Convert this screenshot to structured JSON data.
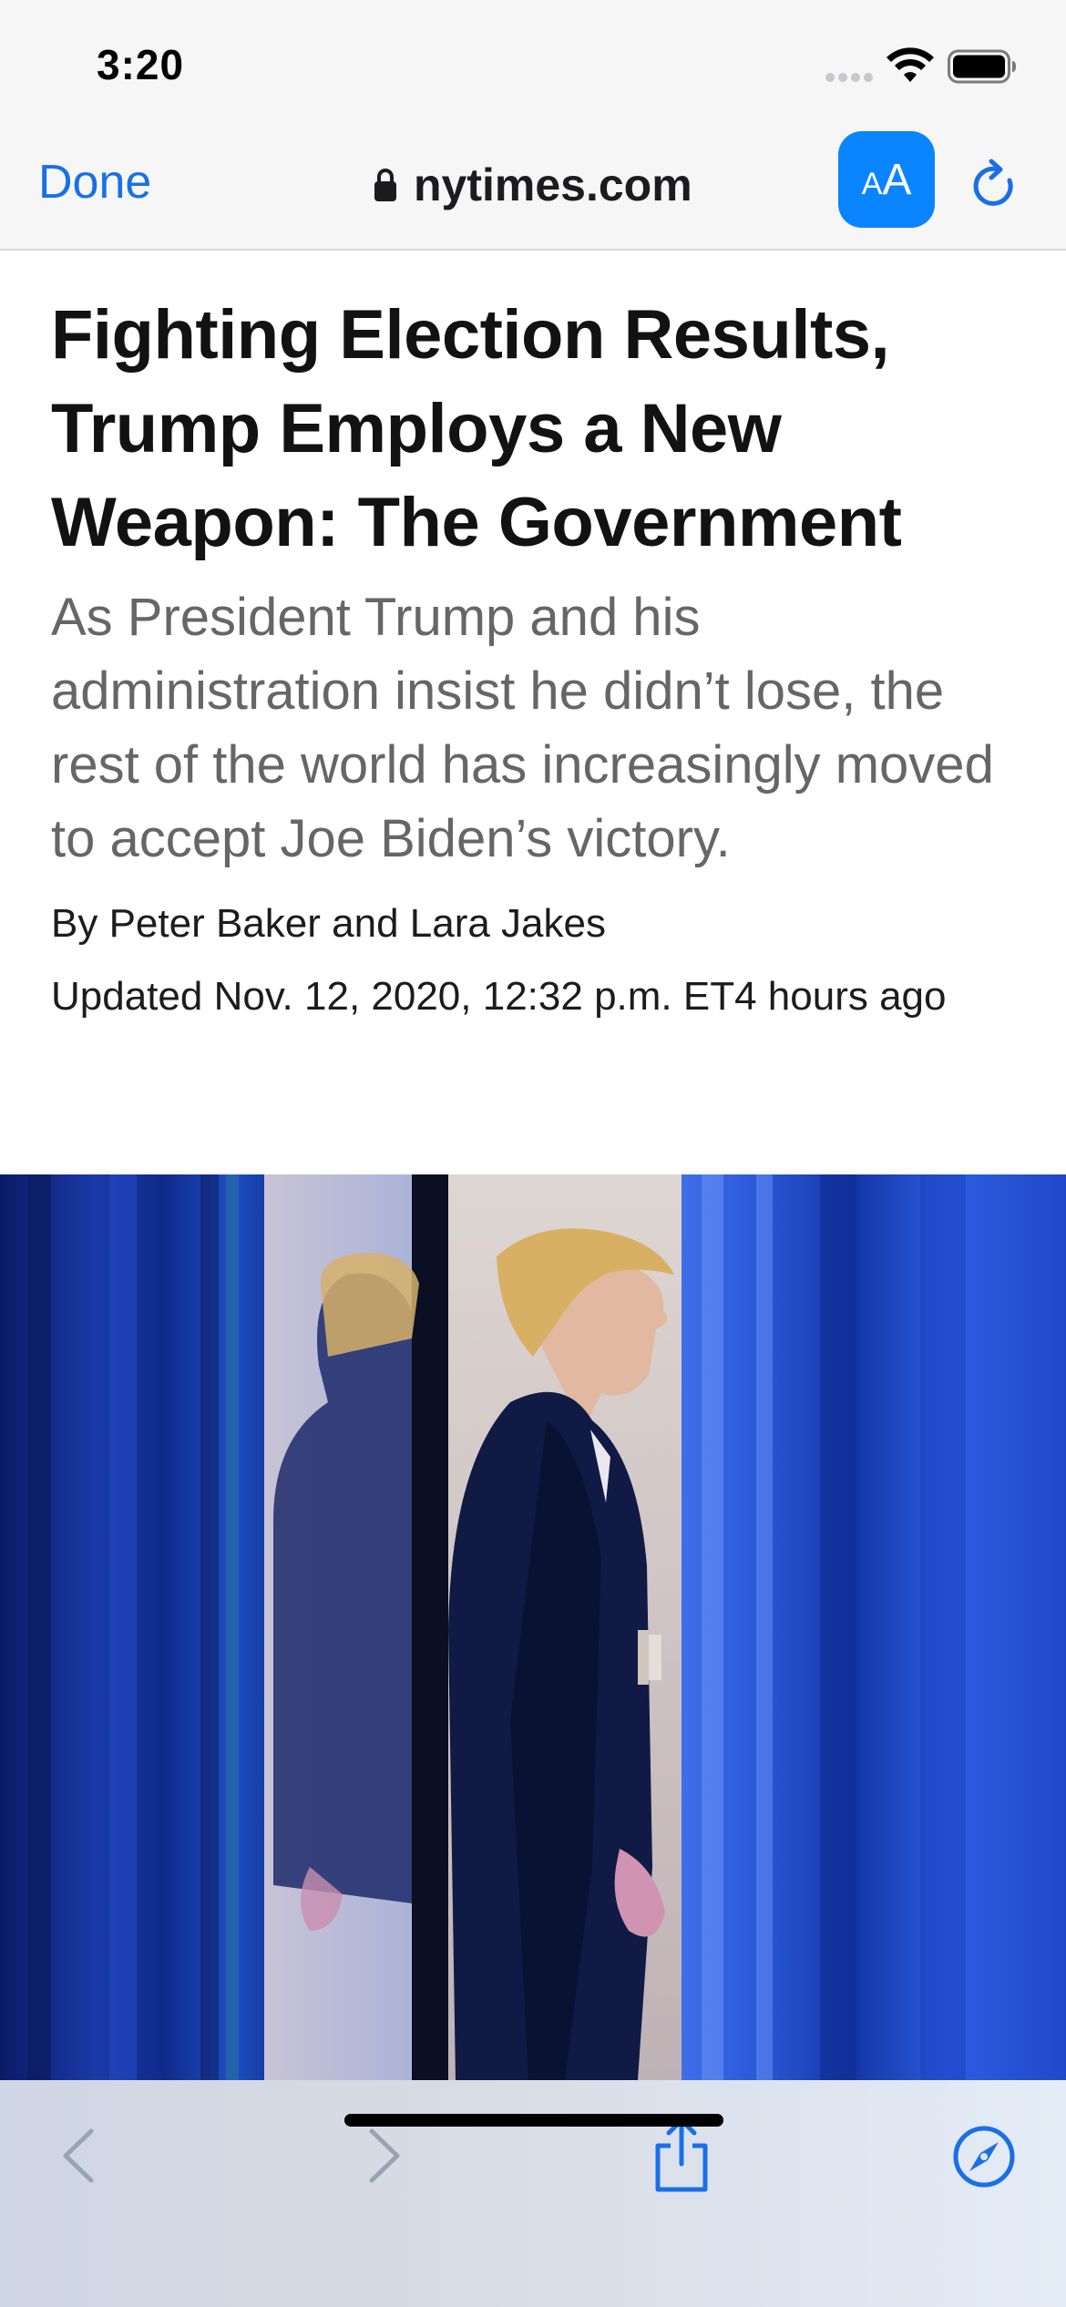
{
  "status_bar": {
    "time": "3:20"
  },
  "nav_bar": {
    "done_label": "Done",
    "url": "nytimes.com",
    "reader_small": "A",
    "reader_big": "A"
  },
  "article": {
    "headline": "Fighting Election Results, Trump Employs a New Weapon: The Government",
    "summary": "As President Trump and his administration insist he didn’t lose, the rest of the world has increasingly moved to accept Joe Biden’s victory.",
    "byline": "By Peter Baker and Lara Jakes",
    "timestamp": "Updated Nov. 12, 2020, 12:32 p.m. ET4 hours ago"
  },
  "toolbar": {
    "icons": [
      "back-chevron-icon",
      "forward-chevron-icon",
      "share-icon",
      "compass-icon"
    ]
  },
  "colors": {
    "accent": "#0a84ff",
    "link": "#1a6fe6",
    "headline": "#121212",
    "summary": "#666666",
    "bar_background": "#f6f6f6"
  }
}
